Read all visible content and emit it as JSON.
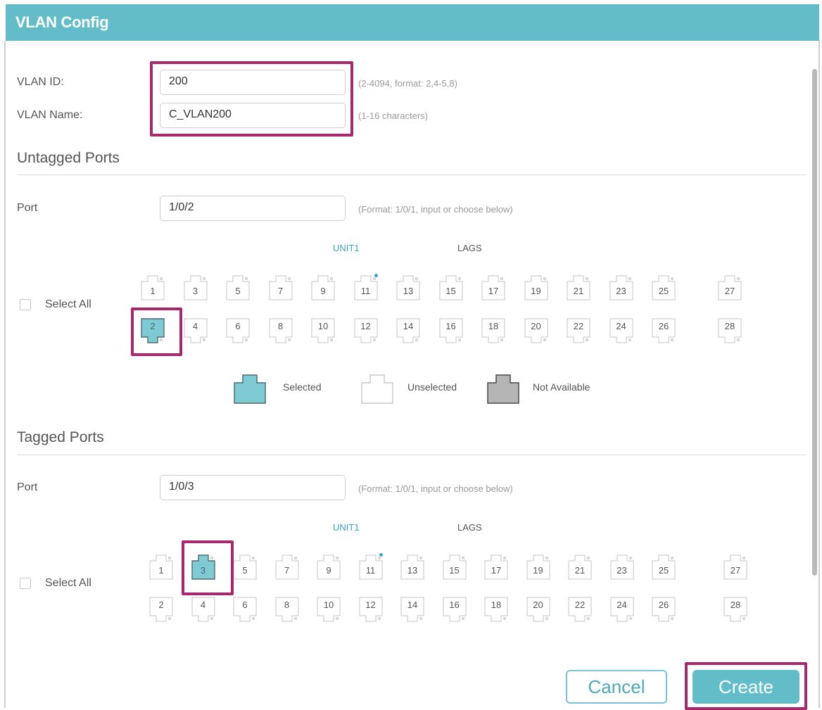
{
  "dialog": {
    "title": "VLAN Config"
  },
  "vlan": {
    "id_label": "VLAN ID:",
    "id_value": "200",
    "id_hint": "(2-4094, format: 2,4-5,8)",
    "name_label": "VLAN Name:",
    "name_value": "C_VLAN200",
    "name_hint": "(1-16 characters)"
  },
  "untagged": {
    "title": "Untagged Ports",
    "port_label": "Port",
    "port_value": "1/0/2",
    "port_hint": "(Format: 1/0/1, input or choose below)",
    "unit_label": "UNIT1",
    "lags_label": "LAGS",
    "select_all": "Select All",
    "selected_port": "2"
  },
  "legend": {
    "selected": "Selected",
    "unselected": "Unselected",
    "not_available": "Not Available"
  },
  "tagged": {
    "title": "Tagged Ports",
    "port_label": "Port",
    "port_value": "1/0/3",
    "port_hint": "(Format: 1/0/1, input or choose below)",
    "unit_label": "UNIT1",
    "lags_label": "LAGS",
    "select_all": "Select All",
    "selected_port": "3"
  },
  "ports": {
    "top_row": [
      "1",
      "3",
      "5",
      "7",
      "9",
      "11",
      "13",
      "15",
      "17",
      "19",
      "21",
      "23",
      "25"
    ],
    "bottom_row": [
      "2",
      "4",
      "6",
      "8",
      "10",
      "12",
      "14",
      "16",
      "18",
      "20",
      "22",
      "24",
      "26"
    ],
    "extra_top": "27",
    "extra_bottom": "28",
    "dot_port": "11"
  },
  "buttons": {
    "cancel": "Cancel",
    "create": "Create"
  },
  "colors": {
    "accent": "#62bdc8",
    "selected_port": "#7fcbd3",
    "not_available": "#b5b5b5",
    "highlight": "#a8296b",
    "link_dot": "#3aa7c0"
  }
}
